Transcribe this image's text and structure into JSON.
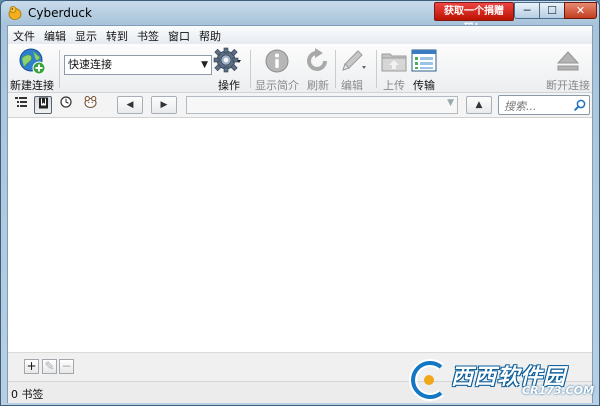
{
  "window": {
    "title": "Cyberduck",
    "promo_label": "获取一个捐赠码！"
  },
  "window_controls": {
    "minimize": "─",
    "maximize": "☐",
    "close": "✕"
  },
  "menu": [
    "文件",
    "编辑",
    "显示",
    "转到",
    "书签",
    "窗口",
    "帮助"
  ],
  "toolbar": {
    "new_connection": "新建连接",
    "quick_connect_value": "快速连接",
    "action": "操作",
    "info": "显示简介",
    "refresh": "刷新",
    "edit": "编辑",
    "upload": "上传",
    "transfers": "传输",
    "disconnect": "断开连接"
  },
  "nav": {
    "back": "◀",
    "forward": "▶",
    "up": "▲",
    "search_placeholder": "搜索..."
  },
  "bottom": {
    "add": "+",
    "edit": "✎",
    "remove": "−"
  },
  "status": {
    "text": "0 书签"
  },
  "watermark": {
    "brand": "西西软件园",
    "url": "CR173.COM"
  },
  "colors": {
    "title_bg": "#b8cfe3",
    "promo": "#cc2211",
    "close": "#c23d1f",
    "accent": "#1e73c2"
  }
}
